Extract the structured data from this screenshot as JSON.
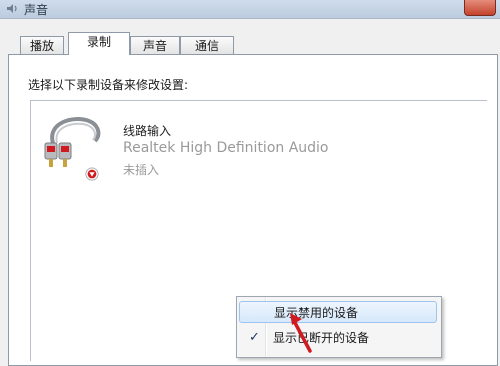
{
  "window": {
    "title": "声音"
  },
  "tabs": [
    {
      "label": "播放",
      "active": false
    },
    {
      "label": "录制",
      "active": true
    },
    {
      "label": "声音",
      "active": false
    },
    {
      "label": "通信",
      "active": false
    }
  ],
  "instruction": "选择以下录制设备来修改设置:",
  "device": {
    "name": "线路输入",
    "description": "Realtek High Definition Audio",
    "status": "未插入",
    "icon": "audio-cable-icon",
    "status_icon": "down-arrow-badge-icon"
  },
  "context_menu": {
    "items": [
      {
        "label": "显示禁用的设备",
        "checked": false,
        "highlighted": true
      },
      {
        "label": "显示已断开的设备",
        "checked": true,
        "highlighted": false
      }
    ],
    "check_glyph": "✓"
  },
  "colors": {
    "accent_red": "#d01a20",
    "highlight_border": "#9cc4ef"
  }
}
